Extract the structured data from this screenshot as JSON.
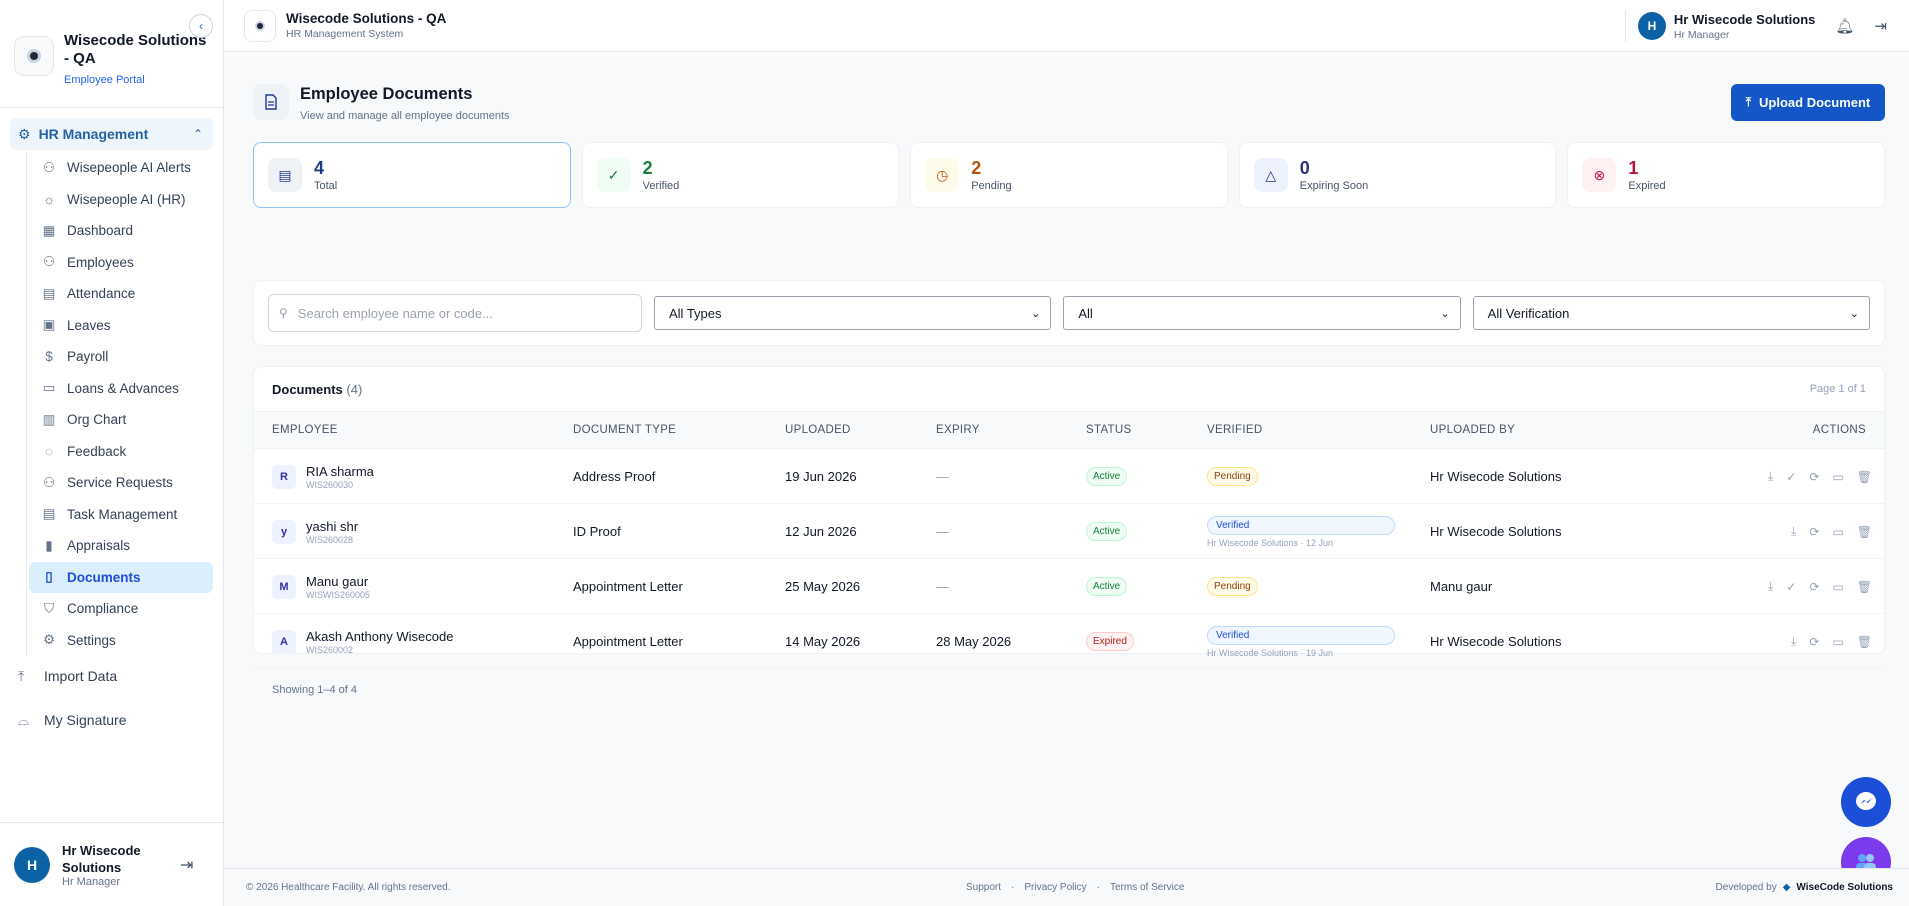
{
  "sidebar": {
    "org_name": "Wisecode Solutions - QA",
    "portal": "Employee Portal",
    "section": "HR Management",
    "items": [
      {
        "label": "Wisepeople AI Alerts",
        "icon": "alerts-icon"
      },
      {
        "label": "Wisepeople AI (HR)",
        "icon": "bulb-icon"
      },
      {
        "label": "Dashboard",
        "icon": "dashboard-icon"
      },
      {
        "label": "Employees",
        "icon": "users-icon"
      },
      {
        "label": "Attendance",
        "icon": "clipboard-icon"
      },
      {
        "label": "Leaves",
        "icon": "calendar-icon"
      },
      {
        "label": "Payroll",
        "icon": "dollar-icon"
      },
      {
        "label": "Loans & Advances",
        "icon": "loan-icon"
      },
      {
        "label": "Org Chart",
        "icon": "org-chart-icon"
      },
      {
        "label": "Feedback",
        "icon": "chat-icon"
      },
      {
        "label": "Service Requests",
        "icon": "users-icon"
      },
      {
        "label": "Task Management",
        "icon": "task-icon"
      },
      {
        "label": "Appraisals",
        "icon": "bar-chart-icon"
      },
      {
        "label": "Documents",
        "icon": "document-icon"
      },
      {
        "label": "Compliance",
        "icon": "shield-icon"
      },
      {
        "label": "Settings",
        "icon": "gear-icon"
      }
    ],
    "import_data": "Import Data",
    "my_signature": "My Signature",
    "user": {
      "initial": "H",
      "name": "Hr Wisecode Solutions",
      "role": "Hr Manager"
    }
  },
  "header": {
    "title": "Wisecode Solutions - QA",
    "subtitle": "HR Management System",
    "user_initial": "H",
    "user_name": "Hr Wisecode Solutions",
    "user_role": "Hr Manager"
  },
  "page": {
    "title": "Employee Documents",
    "subtitle": "View and manage all employee documents",
    "upload_label": "Upload Document"
  },
  "stats": [
    {
      "value": "4",
      "label": "Total",
      "color": "#1e3a8a",
      "bg": "#eef2f7"
    },
    {
      "value": "2",
      "label": "Verified",
      "color": "#15803d",
      "bg": "#f0fdf4"
    },
    {
      "value": "2",
      "label": "Pending",
      "color": "#b45309",
      "bg": "#fffbeb"
    },
    {
      "value": "0",
      "label": "Expiring Soon",
      "color": "#312e81",
      "bg": "#eef2ff"
    },
    {
      "value": "1",
      "label": "Expired",
      "color": "#be123c",
      "bg": "#fff1f2"
    }
  ],
  "filters": {
    "search_placeholder": "Search employee name or code...",
    "type": "All Types",
    "status": "All",
    "verification": "All Verification"
  },
  "table": {
    "title": "Documents",
    "count": "(4)",
    "page": "Page 1 of 1",
    "columns": [
      "EMPLOYEE",
      "DOCUMENT TYPE",
      "UPLOADED",
      "EXPIRY",
      "STATUS",
      "VERIFIED",
      "UPLOADED BY",
      "ACTIONS"
    ],
    "rows": [
      {
        "initial": "R",
        "name": "RIA sharma",
        "code": "WIS260030",
        "type": "Address Proof",
        "uploaded": "19 Jun 2026",
        "expiry": "—",
        "status": "Active",
        "verified": "Pending",
        "verified_by": "",
        "uploaded_by": "Hr Wisecode Solutions"
      },
      {
        "initial": "y",
        "name": "yashi shr",
        "code": "WIS260028",
        "type": "ID Proof",
        "uploaded": "12 Jun 2026",
        "expiry": "—",
        "status": "Active",
        "verified": "Verified",
        "verified_by": "Hr Wisecode Solutions · 12 Jun",
        "uploaded_by": "Hr Wisecode Solutions"
      },
      {
        "initial": "M",
        "name": "Manu gaur",
        "code": "WISWIS260005",
        "type": "Appointment Letter",
        "uploaded": "25 May 2026",
        "expiry": "—",
        "status": "Active",
        "verified": "Pending",
        "verified_by": "",
        "uploaded_by": "Manu gaur"
      },
      {
        "initial": "A",
        "name": "Akash Anthony Wisecode",
        "code": "WIS260002",
        "type": "Appointment Letter",
        "uploaded": "14 May 2026",
        "expiry": "28 May 2026",
        "status": "Expired",
        "verified": "Verified",
        "verified_by": "Hr Wisecode Solutions · 19 Jun",
        "uploaded_by": "Hr Wisecode Solutions"
      }
    ],
    "footer": "Showing 1–4 of 4"
  },
  "footer": {
    "copyright": "© 2026 Healthcare Facility. All rights reserved.",
    "links": [
      "Support",
      "Privacy Policy",
      "Terms of Service"
    ],
    "developed_by": "Developed by",
    "developer": "WiseCode Solutions"
  }
}
